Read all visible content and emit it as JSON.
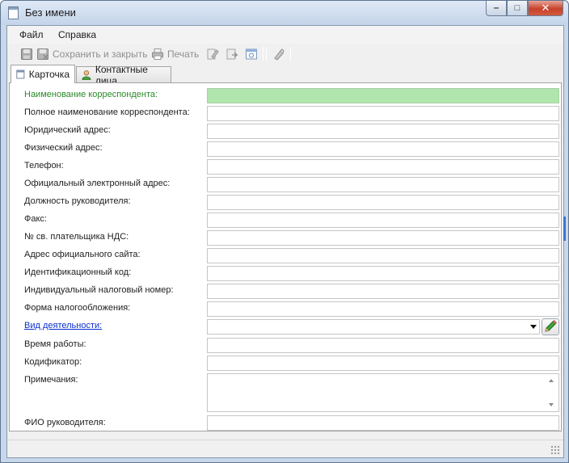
{
  "window": {
    "title": "Без имени"
  },
  "menu": {
    "file": "Файл",
    "help": "Справка"
  },
  "toolbar": {
    "save_close": "Сохранить и закрыть",
    "print": "Печать"
  },
  "tabs": {
    "card": "Карточка",
    "contacts": "Контактные лица"
  },
  "form": {
    "name": "Наименование корреспондента:",
    "full_name": "Полное наименование корреспондента:",
    "legal_address": "Юридический адрес:",
    "physical_address": "Физический адрес:",
    "phone": "Телефон:",
    "email": "Официальный электронный адрес:",
    "head_position": "Должность руководителя:",
    "fax": "Факс:",
    "vat_cert": "№ св. плательщика НДС:",
    "website": "Адрес официального сайта:",
    "id_code": "Идентификационный код:",
    "tax_number": "Индивидуальный налоговый номер:",
    "taxation_form": "Форма налогообложения:",
    "activity": "Вид деятельности:",
    "working_hours": "Время работы:",
    "codifier": "Кодификатор:",
    "notes": "Примечания:",
    "head_name": "ФИО руководителя:"
  },
  "colors": {
    "required_field": "#b0e6ad",
    "required_label": "#2a8a2a",
    "link": "#0a2fd0"
  }
}
